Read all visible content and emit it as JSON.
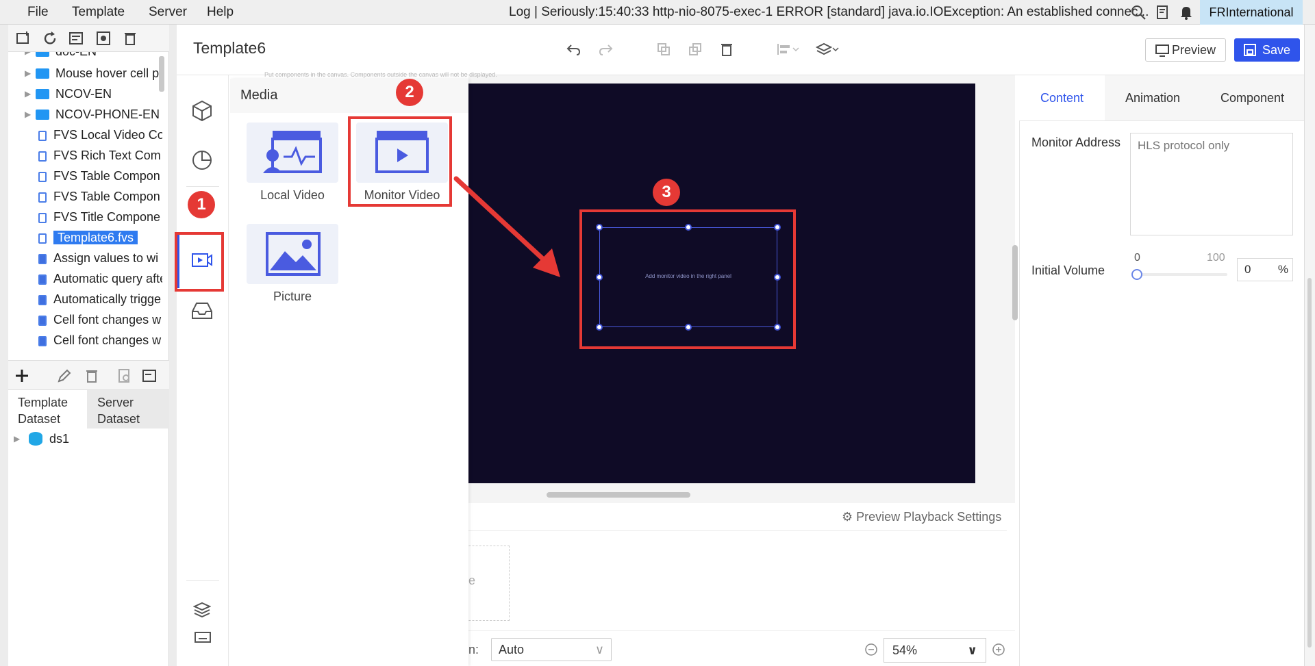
{
  "menubar": {
    "items": [
      "File",
      "Template",
      "Server",
      "Help"
    ],
    "log_text": "Log | Seriously:15:40:33 http-nio-8075-exec-1 ERROR [standard] java.io.IOException: An established connec...",
    "user": "FRInternational"
  },
  "tree": {
    "items": [
      {
        "label": "doc-EN",
        "type": "folder"
      },
      {
        "label": "Mouse hover cell pi",
        "type": "folder"
      },
      {
        "label": "NCOV-EN",
        "type": "folder"
      },
      {
        "label": "NCOV-PHONE-EN",
        "type": "folder"
      },
      {
        "label": "FVS Local Video Co",
        "type": "file"
      },
      {
        "label": "FVS Rich Text Com",
        "type": "file"
      },
      {
        "label": "FVS Table Compon",
        "type": "file"
      },
      {
        "label": "FVS Table Compon",
        "type": "file"
      },
      {
        "label": "FVS Title Compone",
        "type": "file"
      },
      {
        "label": "Template6.fvs",
        "type": "file"
      },
      {
        "label": "Assign values to wi",
        "type": "report"
      },
      {
        "label": "Automatic query afte",
        "type": "report"
      },
      {
        "label": "Automatically trigge",
        "type": "report"
      },
      {
        "label": "Cell font changes w",
        "type": "report"
      },
      {
        "label": "Cell font changes w",
        "type": "report"
      }
    ]
  },
  "dataset": {
    "tab_template": "Template Dataset",
    "tab_server": "Server Dataset",
    "item": "ds1"
  },
  "editor": {
    "title": "Template6",
    "preview_label": "Preview",
    "save_label": "Save"
  },
  "media": {
    "title": "Media",
    "local_video": "Local Video",
    "monitor_video": "Monitor Video",
    "picture": "Picture"
  },
  "canvas": {
    "hint": "Put components in the canvas. Components outside the canvas will not be displayed.",
    "component_text": "Add monitor video in the right panel"
  },
  "bottom": {
    "preview_playback": "Preview Playback Settings",
    "partial_label": "ge",
    "adapt_label": "n:",
    "adapt_value": "Auto",
    "zoom_value": "54%"
  },
  "right_panel": {
    "tabs": [
      "Content",
      "Animation",
      "Component"
    ],
    "monitor_address_label": "Monitor Address",
    "monitor_address_placeholder": "HLS protocol only",
    "initial_volume_label": "Initial Volume",
    "slider_min": "0",
    "slider_max": "100",
    "volume_value": "0",
    "volume_unit": "%"
  },
  "annotations": [
    "1",
    "2",
    "3"
  ],
  "colors": {
    "accent": "#2f54eb",
    "annotation_red": "#e53935",
    "canvas_bg": "#0f0b26"
  }
}
